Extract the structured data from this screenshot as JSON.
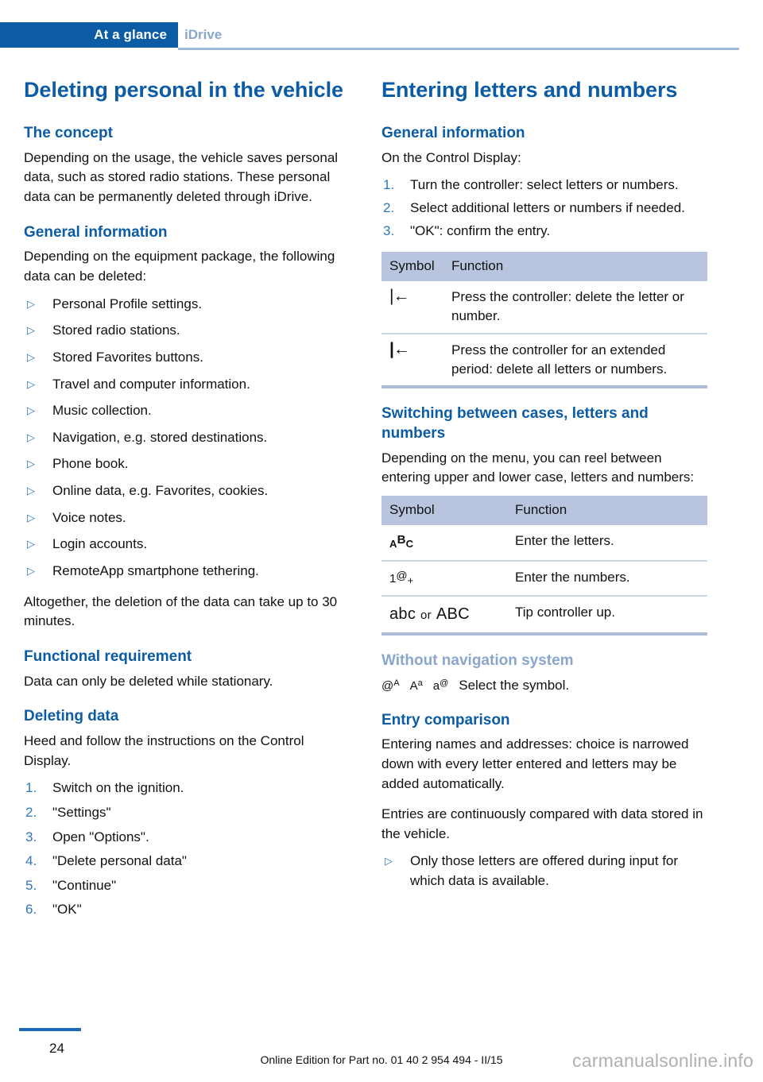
{
  "header": {
    "chapter_tab": "At a glance",
    "section_tab": "iDrive",
    "accent_color": "#0b5ca5",
    "tab_muted_color": "#8aa6cc"
  },
  "left_column": {
    "title": "Deleting personal in the vehicle",
    "sections": [
      {
        "heading": "The concept",
        "paragraphs": [
          "Depending on the usage, the vehicle saves personal data, such as stored radio stations. These personal data can be permanently deleted through iDrive."
        ]
      },
      {
        "heading": "General information",
        "intro": "Depending on the equipment package, the following data can be deleted:",
        "bullets": [
          "Personal Profile settings.",
          "Stored radio stations.",
          "Stored Favorites buttons.",
          "Travel and computer information.",
          "Music collection.",
          "Navigation, e.g. stored destinations.",
          "Phone book.",
          "Online data, e.g. Favorites, cookies.",
          "Voice notes.",
          "Login accounts.",
          "RemoteApp smartphone tethering."
        ],
        "outro": "Altogether, the deletion of the data can take up to 30 minutes."
      },
      {
        "heading": "Functional requirement",
        "paragraphs": [
          "Data can only be deleted while stationary."
        ]
      },
      {
        "heading": "Deleting data",
        "intro": "Heed and follow the instructions on the Control Display.",
        "steps": [
          "Switch on the ignition.",
          "\"Settings\"",
          "Open \"Options\".",
          "\"Delete personal data\"",
          "\"Continue\"",
          "\"OK\""
        ]
      }
    ]
  },
  "right_column": {
    "title": "Entering letters and numbers",
    "general_information": {
      "heading": "General information",
      "intro": "On the Control Display:",
      "steps": [
        "Turn the controller: select letters or numbers.",
        "Select additional letters or numbers if needed.",
        "\"OK\": confirm the entry."
      ]
    },
    "delete_table": {
      "columns": [
        "Symbol",
        "Function"
      ],
      "rows": [
        {
          "symbol_name": "backspace-icon",
          "symbol_glyph": "|←",
          "function": "Press the controller: delete the letter or number."
        },
        {
          "symbol_name": "backspace-bold-icon",
          "symbol_glyph": "|←",
          "function": "Press the controller for an extended period: delete all letters or numbers."
        }
      ]
    },
    "switching_section": {
      "heading": "Switching between cases, letters and numbers",
      "intro": "Depending on the menu, you can reel between entering upper and lower case, letters and numbers:",
      "table": {
        "columns": [
          "Symbol",
          "Function"
        ],
        "rows": [
          {
            "symbol_name": "letters-abc-icon",
            "symbol_parts": {
              "a": "A",
              "b": "B",
              "c": "C"
            },
            "function": "Enter the letters."
          },
          {
            "symbol_name": "numbers-at-plus-icon",
            "symbol_parts": {
              "one": "1",
              "at": "@",
              "plus": "+"
            },
            "function": "Enter the numbers."
          },
          {
            "symbol_name": "case-toggle-icon",
            "symbol_parts": {
              "lower": "abc",
              "conjunction": "or",
              "upper": "ABC"
            },
            "function": "Tip controller up."
          }
        ]
      }
    },
    "without_navigation": {
      "heading": "Without navigation system",
      "symbols": [
        {
          "name": "at-upper-a-icon",
          "base": "@",
          "sup": "A"
        },
        {
          "name": "upper-a-lower-a-icon",
          "base": "A",
          "sup": "a"
        },
        {
          "name": "lower-a-at-icon",
          "base": "a",
          "sup": "@"
        }
      ],
      "text": "Select the symbol."
    },
    "entry_comparison": {
      "heading": "Entry comparison",
      "paragraphs": [
        "Entering names and addresses: choice is narrowed down with every letter entered and letters may be added automatically.",
        "Entries are continuously compared with data stored in the vehicle."
      ],
      "bullets": [
        "Only those letters are offered during input for which data is available."
      ]
    }
  },
  "footer": {
    "page_number": "24",
    "edition_text": "Online Edition for Part no. 01 40 2 954 494 - II/15",
    "watermark": "carmanualsonline.info"
  }
}
